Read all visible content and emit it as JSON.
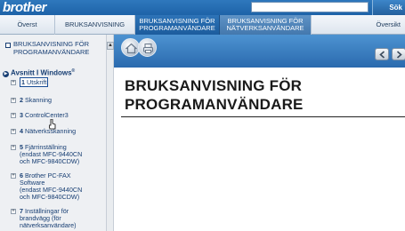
{
  "header": {
    "logo": "brother",
    "search_placeholder": "",
    "search_button": "Sök"
  },
  "nav": {
    "tabs": [
      {
        "label": "Överst"
      },
      {
        "label": "BRUKSANVISNING"
      },
      {
        "line1": "BRUKSANVISNING FÖR",
        "line2": "PROGRAMANVÄNDARE",
        "active": true
      },
      {
        "line1": "BRUKSANVISNING FÖR",
        "line2": "NÄTVERKSANVÄNDARE"
      },
      {
        "label": "Översikt"
      }
    ]
  },
  "sidebar": {
    "root_line1": "BRUKSANVISNING FÖR",
    "root_line2": "PROGRAMANVÄNDARE",
    "chapter": "Avsnitt I Windows",
    "chapter_sup": "®",
    "items": [
      {
        "num": "1",
        "label": "Utskrift",
        "selected": true
      },
      {
        "num": "2",
        "label": "Skanning"
      },
      {
        "num": "3",
        "label": "ControlCenter3"
      },
      {
        "num": "4",
        "label": "Nätverksskanning"
      },
      {
        "num": "5",
        "label": "Fjärrinställning",
        "extra": [
          "(endast MFC-9440CN",
          "och MFC-9840CDW)"
        ]
      },
      {
        "num": "6",
        "label": "Brother PC-FAX",
        "extra": [
          "Software",
          "(endast MFC-9440CN",
          "och MFC-9840CDW)"
        ]
      },
      {
        "num": "7",
        "label": "Inställningar för",
        "extra": [
          "brandvägg (för",
          "nätverksanvändare)"
        ]
      }
    ]
  },
  "main": {
    "title_line1": "BRUKSANVISNING FÖR",
    "title_line2": "PROGRAMANVÄNDARE"
  },
  "colors": {
    "header_blue": "#1e63a8",
    "active_tab": "#2e74b8",
    "sidebar_bg": "#eef0f3",
    "link_text": "#173e73"
  }
}
